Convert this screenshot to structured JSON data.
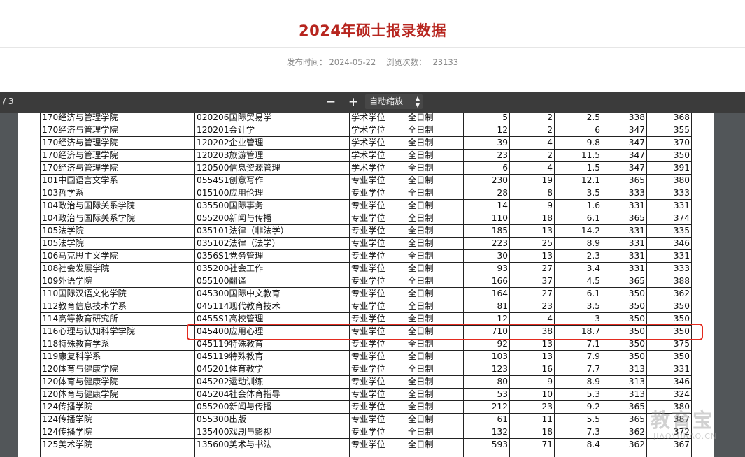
{
  "page": {
    "title": "2024年硕士报录数据",
    "publish_label": "发布时间：",
    "publish_date": "2024-05-22",
    "views_label": "浏览次数：",
    "views_count": "23133"
  },
  "toolbar": {
    "page_indicator": "/ 3",
    "zoom_out": "−",
    "zoom_in": "+",
    "zoom_value": "自动缩放"
  },
  "table": {
    "rows": [
      [
        "170经济与管理学院",
        "020206国际贸易学",
        "学术学位",
        "全日制",
        "5",
        "2",
        "2.5",
        "338",
        "368"
      ],
      [
        "170经济与管理学院",
        "120201会计学",
        "学术学位",
        "全日制",
        "12",
        "2",
        "6",
        "347",
        "355"
      ],
      [
        "170经济与管理学院",
        "120202企业管理",
        "学术学位",
        "全日制",
        "39",
        "4",
        "9.8",
        "347",
        "370"
      ],
      [
        "170经济与管理学院",
        "120203旅游管理",
        "学术学位",
        "全日制",
        "23",
        "2",
        "11.5",
        "347",
        "350"
      ],
      [
        "170经济与管理学院",
        "120500信息资源管理",
        "学术学位",
        "全日制",
        "6",
        "4",
        "1.5",
        "347",
        "391"
      ],
      [
        "101中国语言文学系",
        "0554S1创意写作",
        "专业学位",
        "全日制",
        "230",
        "19",
        "12.1",
        "365",
        "380"
      ],
      [
        "103哲学系",
        "015100应用伦理",
        "专业学位",
        "全日制",
        "28",
        "8",
        "3.5",
        "333",
        "333"
      ],
      [
        "104政治与国际关系学院",
        "035500国际事务",
        "专业学位",
        "全日制",
        "14",
        "9",
        "1.6",
        "331",
        "331"
      ],
      [
        "104政治与国际关系学院",
        "055200新闻与传播",
        "专业学位",
        "全日制",
        "110",
        "18",
        "6.1",
        "365",
        "374"
      ],
      [
        "105法学院",
        "035101法律（非法学）",
        "专业学位",
        "全日制",
        "185",
        "13",
        "14.2",
        "331",
        "335"
      ],
      [
        "105法学院",
        "035102法律（法学）",
        "专业学位",
        "全日制",
        "223",
        "25",
        "8.9",
        "331",
        "346"
      ],
      [
        "106马克思主义学院",
        "0356S1党务管理",
        "专业学位",
        "全日制",
        "30",
        "13",
        "2.3",
        "331",
        "331"
      ],
      [
        "108社会发展学院",
        "035200社会工作",
        "专业学位",
        "全日制",
        "93",
        "27",
        "3.4",
        "331",
        "333"
      ],
      [
        "109外语学院",
        "055100翻译",
        "专业学位",
        "全日制",
        "166",
        "37",
        "4.5",
        "365",
        "388"
      ],
      [
        "110国际汉语文化学院",
        "045300国际中文教育",
        "专业学位",
        "全日制",
        "164",
        "27",
        "6.1",
        "350",
        "362"
      ],
      [
        "112教育信息技术学系",
        "045114现代教育技术",
        "专业学位",
        "全日制",
        "81",
        "23",
        "3.5",
        "350",
        "350"
      ],
      [
        "114高等教育研究所",
        "0455S1高校管理",
        "专业学位",
        "全日制",
        "12",
        "4",
        "3",
        "350",
        "350"
      ],
      [
        "116心理与认知科学学院",
        "045400应用心理",
        "专业学位",
        "全日制",
        "710",
        "38",
        "18.7",
        "350",
        "350"
      ],
      [
        "118特殊教育学系",
        "045119特殊教育",
        "专业学位",
        "全日制",
        "92",
        "13",
        "7.1",
        "350",
        "375"
      ],
      [
        "119康复科学系",
        "045119特殊教育",
        "专业学位",
        "全日制",
        "103",
        "13",
        "7.9",
        "350",
        "350"
      ],
      [
        "120体育与健康学院",
        "045201体育教学",
        "专业学位",
        "全日制",
        "123",
        "16",
        "7.7",
        "313",
        "331"
      ],
      [
        "120体育与健康学院",
        "045202运动训练",
        "专业学位",
        "全日制",
        "80",
        "9",
        "8.9",
        "313",
        "346"
      ],
      [
        "120体育与健康学院",
        "045204社会体育指导",
        "专业学位",
        "全日制",
        "53",
        "10",
        "5.3",
        "313",
        "324"
      ],
      [
        "124传播学院",
        "055200新闻与传播",
        "专业学位",
        "全日制",
        "212",
        "23",
        "9.2",
        "365",
        "380"
      ],
      [
        "124传播学院",
        "055300出版",
        "专业学位",
        "全日制",
        "61",
        "11",
        "5.5",
        "365",
        "387"
      ],
      [
        "124传播学院",
        "135400戏剧与影视",
        "专业学位",
        "全日制",
        "132",
        "18",
        "7.3",
        "362",
        "372"
      ],
      [
        "125美术学院",
        "135600美术与书法",
        "专业学位",
        "全日制",
        "593",
        "71",
        "8.4",
        "362",
        "367"
      ],
      [
        "",
        "",
        "",
        "",
        "",
        "",
        "",
        "",
        ""
      ]
    ]
  },
  "watermark": {
    "logo_text": "教育宝",
    "url_text": "JIAOYUBAO.CN"
  }
}
